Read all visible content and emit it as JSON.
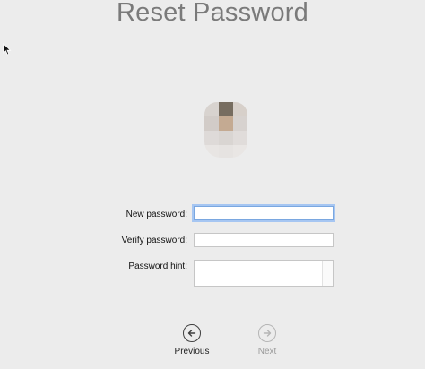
{
  "window": {
    "title": "Reset Password"
  },
  "form": {
    "new_password_label": "New password:",
    "new_password_value": "",
    "verify_password_label": "Verify password:",
    "verify_password_value": "",
    "password_hint_label": "Password hint:",
    "password_hint_value": ""
  },
  "navigation": {
    "previous_label": "Previous",
    "next_label": "Next",
    "previous_icon": "arrow-left-circle-icon",
    "next_icon": "arrow-right-circle-icon"
  },
  "colors": {
    "background": "#ececec",
    "title": "#7a7a7a",
    "focus_ring": "#a6c6f2",
    "enabled_text": "#222222",
    "disabled_text": "#9a9a9a"
  }
}
